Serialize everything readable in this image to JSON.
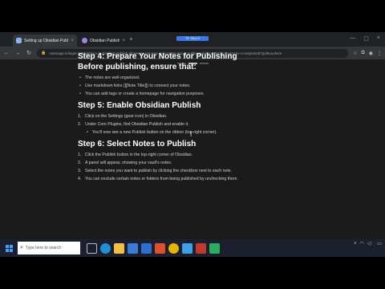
{
  "browser": {
    "tabs": [
      {
        "title": "Setting up Obsidian Publish wi",
        "close": "×"
      },
      {
        "title": "Obsidian Publish",
        "close": "×"
      }
    ],
    "new_tab": "+",
    "recording_title": "TE TALLS",
    "window_controls": [
      "—",
      "▢",
      "×"
    ],
    "url": "notesapp.in/login-105/setting-up-obsidian-publish-allows-you-to-turn-your-notes-into-a-public-website-making-it-easy-to-s-ce4pe2e3t7gxf5uuvbs/e"
  },
  "article": {
    "step4_heading": "Step 4: Prepare Your Notes for Publishing",
    "step4_subheading": "Before publishing, ensure that:",
    "step4_bullets": [
      "The notes are well-organized.",
      "Use markdown links ([[Note Title]]) to connect your notes.",
      "You can add tags or create a homepage for navigation purposes."
    ],
    "step5_heading": "Step 5: Enable Obsidian Publish",
    "step5_items": [
      {
        "num": "1.",
        "text": "Click on the Settings (gear icon) in Obsidian."
      },
      {
        "num": "2.",
        "text": "Under Core Plugins, find Obsidian Publish and enable it."
      }
    ],
    "step5_sub": "You'll now see a new Publish button on the ribbon (top-right corner).",
    "step6_heading": "Step 6: Select Notes to Publish",
    "step6_items": [
      {
        "num": "1.",
        "text": "Click the Publish button in the top-right corner of Obsidian."
      },
      {
        "num": "2.",
        "text": "A panel will appear, showing your vault's notes."
      },
      {
        "num": "3.",
        "text": "Select the notes you want to publish by clicking the checkbox next to each note."
      },
      {
        "num": "4.",
        "text": "You can exclude certain notes or folders from being published by unchecking them."
      }
    ]
  },
  "taskbar": {
    "search_placeholder": "Type here to search",
    "clock_time": "",
    "clock_date": ""
  },
  "colors": {
    "accent": "#3b78e7",
    "taskbar": "#1c1f2e",
    "page_bg": "#1b1b1b"
  }
}
